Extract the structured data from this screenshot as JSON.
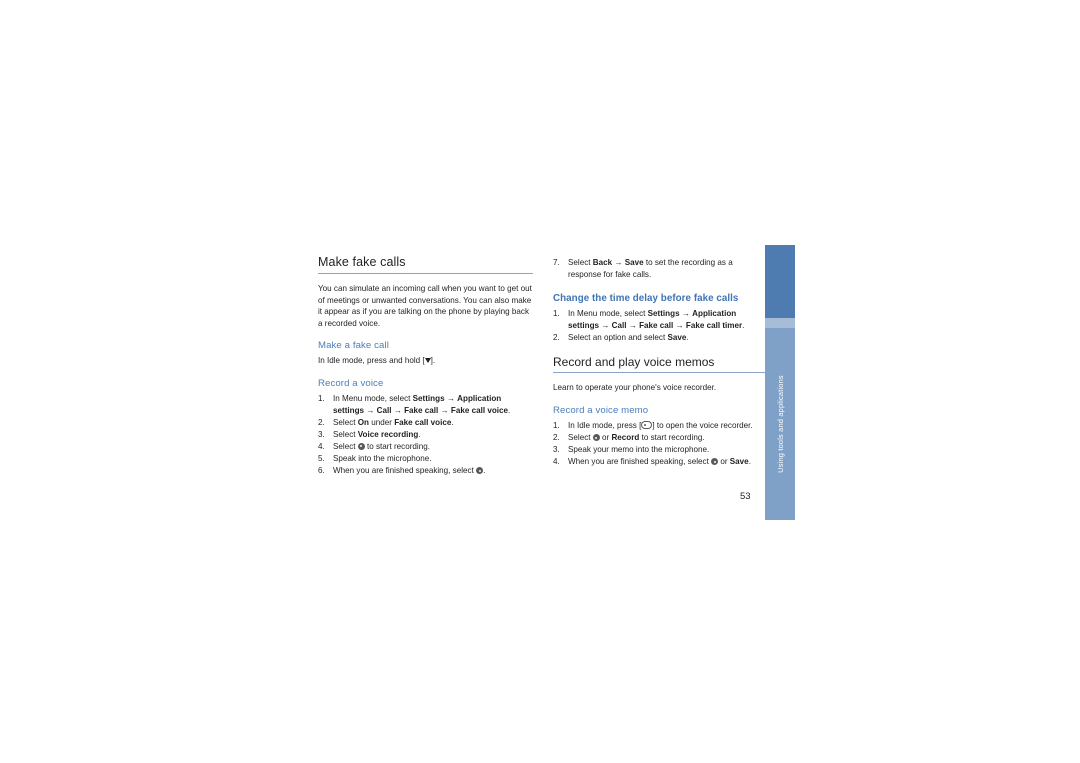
{
  "page": {
    "number": "53",
    "side_tab_label": "Using tools and applications"
  },
  "left_column": {
    "title": "Make fake calls",
    "intro": "You can simulate an incoming call when you want to get out of meetings or unwanted conversations. You can also make it appear as if you are talking on the phone by playing back a recorded voice.",
    "section_make_fake_call": {
      "heading": "Make a fake call",
      "text_before": "In Idle mode, press and hold [",
      "text_after": "]."
    },
    "section_record_voice": {
      "heading": "Record a voice",
      "steps": [
        {
          "num": "1.",
          "parts": [
            {
              "t": "In Menu mode, select ",
              "b": false
            },
            {
              "t": "Settings",
              "b": true
            },
            {
              "t": " → ",
              "b": false
            },
            {
              "t": "Application settings",
              "b": true
            },
            {
              "t": " → ",
              "b": false
            },
            {
              "t": "Call",
              "b": true
            },
            {
              "t": " → ",
              "b": false
            },
            {
              "t": "Fake call",
              "b": true
            },
            {
              "t": " → ",
              "b": false
            },
            {
              "t": "Fake call voice",
              "b": true
            },
            {
              "t": ".",
              "b": false
            }
          ]
        },
        {
          "num": "2.",
          "parts": [
            {
              "t": "Select ",
              "b": false
            },
            {
              "t": "On",
              "b": true
            },
            {
              "t": " under ",
              "b": false
            },
            {
              "t": "Fake call voice",
              "b": true
            },
            {
              "t": ".",
              "b": false
            }
          ]
        },
        {
          "num": "3.",
          "parts": [
            {
              "t": "Select ",
              "b": false
            },
            {
              "t": "Voice recording",
              "b": true
            },
            {
              "t": ".",
              "b": false
            }
          ]
        },
        {
          "num": "4.",
          "parts": [
            {
              "t": "Select ",
              "b": false
            },
            {
              "t": "[KEY-CIRCLE]",
              "b": false
            },
            {
              "t": " to start recording.",
              "b": false
            }
          ]
        },
        {
          "num": "5.",
          "parts": [
            {
              "t": "Speak into the microphone.",
              "b": false
            }
          ]
        },
        {
          "num": "6.",
          "parts": [
            {
              "t": "When you are finished speaking, select ",
              "b": false
            },
            {
              "t": "[KEY-CIRCLE]",
              "b": false
            },
            {
              "t": ".",
              "b": false
            }
          ]
        }
      ]
    }
  },
  "right_column": {
    "step7": {
      "num": "7.",
      "parts": [
        {
          "t": "Select ",
          "b": false
        },
        {
          "t": "Back",
          "b": true
        },
        {
          "t": " → ",
          "b": false
        },
        {
          "t": "Save",
          "b": true
        },
        {
          "t": " to set the recording as a response for fake calls.",
          "b": false
        }
      ]
    },
    "section_time_delay": {
      "heading": "Change the time delay before fake calls",
      "steps": [
        {
          "num": "1.",
          "parts": [
            {
              "t": "In Menu mode, select ",
              "b": false
            },
            {
              "t": "Settings",
              "b": true
            },
            {
              "t": " → ",
              "b": false
            },
            {
              "t": "Application settings",
              "b": true
            },
            {
              "t": " → ",
              "b": false
            },
            {
              "t": "Call",
              "b": true
            },
            {
              "t": " → ",
              "b": false
            },
            {
              "t": "Fake call",
              "b": true
            },
            {
              "t": " → ",
              "b": false
            },
            {
              "t": "Fake call timer",
              "b": true
            },
            {
              "t": ".",
              "b": false
            }
          ]
        },
        {
          "num": "2.",
          "parts": [
            {
              "t": "Select an option and select ",
              "b": false
            },
            {
              "t": "Save",
              "b": true
            },
            {
              "t": ".",
              "b": false
            }
          ]
        }
      ]
    },
    "section_voice_memos": {
      "title": "Record and play voice memos",
      "intro": "Learn to operate your phone's voice recorder.",
      "heading": "Record a voice memo",
      "steps": [
        {
          "num": "1.",
          "parts": [
            {
              "t": "In Idle mode, press [",
              "b": false
            },
            {
              "t": "[KEY-OVAL]",
              "b": false
            },
            {
              "t": "] to open the voice recorder.",
              "b": false
            }
          ]
        },
        {
          "num": "2.",
          "parts": [
            {
              "t": "Select ",
              "b": false
            },
            {
              "t": "[KEY-CIRCLE]",
              "b": false
            },
            {
              "t": " or ",
              "b": false
            },
            {
              "t": "Record",
              "b": true
            },
            {
              "t": " to start recording.",
              "b": false
            }
          ]
        },
        {
          "num": "3.",
          "parts": [
            {
              "t": "Speak your memo into the microphone.",
              "b": false
            }
          ]
        },
        {
          "num": "4.",
          "parts": [
            {
              "t": "When you are finished speaking, select ",
              "b": false
            },
            {
              "t": "[KEY-CIRCLE]",
              "b": false
            },
            {
              "t": " or ",
              "b": false
            },
            {
              "t": "Save",
              "b": true
            },
            {
              "t": ".",
              "b": false
            }
          ]
        }
      ]
    }
  }
}
